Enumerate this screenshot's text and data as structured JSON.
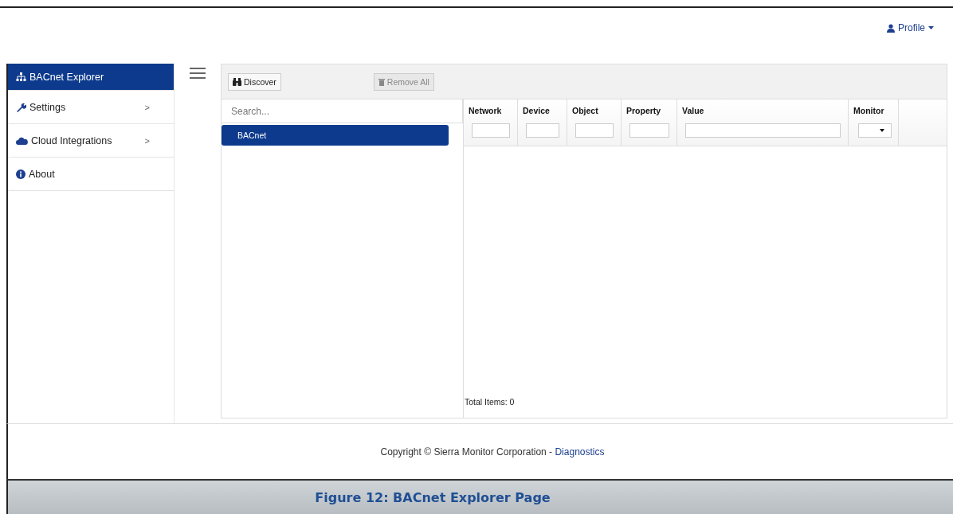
{
  "header": {
    "profile_label": "Profile"
  },
  "sidebar": {
    "items": [
      {
        "label": "BACnet Explorer",
        "selected": true
      },
      {
        "label": "Settings",
        "selected": false,
        "chevron": ">"
      },
      {
        "label": "Cloud Integrations",
        "selected": false,
        "chevron": ">"
      },
      {
        "label": "About",
        "selected": false
      }
    ]
  },
  "toolbar": {
    "buttons": [
      {
        "label": "Discover",
        "disabled": false
      },
      {
        "label": "Remove All",
        "disabled": true
      }
    ]
  },
  "tree": {
    "search": {
      "placeholder": "Search..."
    },
    "items": [
      {
        "label": "BACnet",
        "selected": true
      }
    ]
  },
  "table": {
    "columns": [
      {
        "label": "Network",
        "kind": "text"
      },
      {
        "label": "Device",
        "kind": "text"
      },
      {
        "label": "Object",
        "kind": "text"
      },
      {
        "label": "Property",
        "kind": "text"
      },
      {
        "label": "Value",
        "kind": "text"
      },
      {
        "label": "Monitor",
        "kind": "select"
      }
    ],
    "total": "Total Items: 0"
  },
  "footer": {
    "text": "Copyright © Sierra Monitor Corporation - ",
    "link": "Diagnostics"
  },
  "caption": "Figure 12: BACnet Explorer Page"
}
